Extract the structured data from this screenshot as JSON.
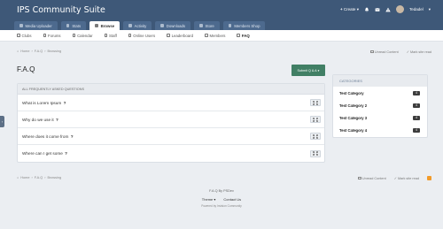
{
  "site": {
    "title": "IPS Community Suite"
  },
  "user_bar": {
    "create_label": "Create",
    "username": "Tedadel"
  },
  "nav": {
    "tabs": [
      {
        "label": "Media Uploader",
        "active": false
      },
      {
        "label": "Stats",
        "active": false
      },
      {
        "label": "Browse",
        "active": true
      },
      {
        "label": "Activity",
        "active": false
      },
      {
        "label": "Downloads",
        "active": false
      },
      {
        "label": "Store",
        "active": false
      },
      {
        "label": "Members Shop",
        "active": false
      }
    ]
  },
  "subnav": {
    "items": [
      {
        "label": "Clubs"
      },
      {
        "label": "Forums"
      },
      {
        "label": "Calendar"
      },
      {
        "label": "Staff"
      },
      {
        "label": "Online Users"
      },
      {
        "label": "Leaderboard"
      },
      {
        "label": "Members"
      },
      {
        "label": "FAQ"
      }
    ]
  },
  "breadcrumb": {
    "home": "Home",
    "section": "F.A.Q",
    "current": "Browsing"
  },
  "page_actions": {
    "unread": "Unread Content",
    "mark_read": "Mark site read"
  },
  "page": {
    "title": "F.A.Q",
    "submit_label": "Submit Q & A"
  },
  "faq": {
    "header": "ALL FREQUENTLY ASKED QUESTIONS",
    "questions": [
      {
        "text": "What is Lorem Ipsum",
        "mark": "?"
      },
      {
        "text": "Why do we use it",
        "mark": "?"
      },
      {
        "text": "Where does it come from",
        "mark": "?"
      },
      {
        "text": "Where can I get some",
        "mark": "?"
      }
    ]
  },
  "categories": {
    "header": "CATEGORIES",
    "items": [
      {
        "name": "Test Category",
        "count": "4"
      },
      {
        "name": "Test Category 2",
        "count": "4"
      },
      {
        "name": "Test Category 3",
        "count": "4"
      },
      {
        "name": "Test Category 4",
        "count": "4"
      }
    ]
  },
  "footer": {
    "credit": "F.A.Q By PSDev",
    "theme_label": "Theme",
    "contact_label": "Contact Us",
    "powered": "Powered by Invision Community"
  },
  "colors": {
    "header": "#3e5878",
    "submit": "#417f65",
    "rss": "#f29b2a"
  }
}
